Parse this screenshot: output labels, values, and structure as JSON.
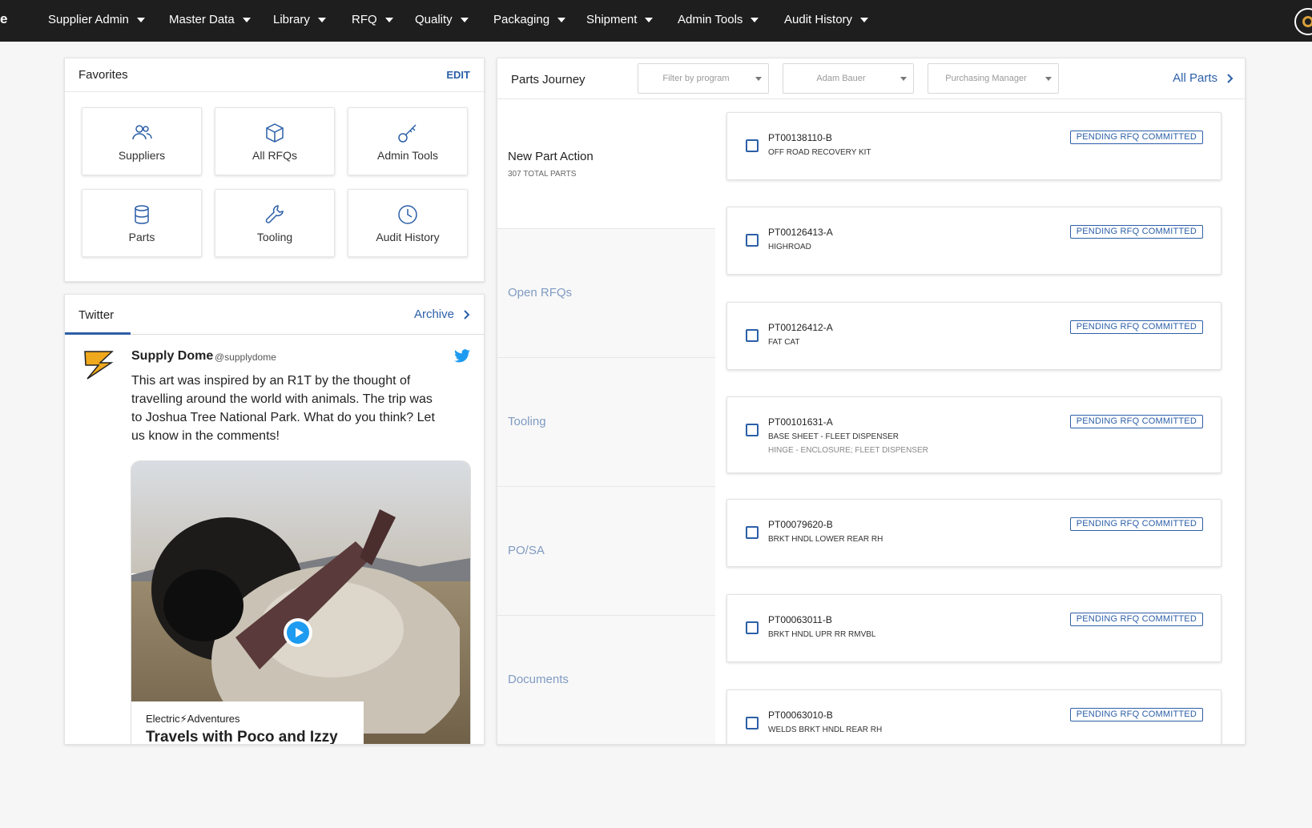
{
  "nav": {
    "brand_fragment": "e",
    "items": [
      {
        "label": "Supplier Admin"
      },
      {
        "label": "Master Data"
      },
      {
        "label": "Library"
      },
      {
        "label": "RFQ"
      },
      {
        "label": "Quality"
      },
      {
        "label": "Packaging"
      },
      {
        "label": "Shipment"
      },
      {
        "label": "Admin Tools"
      },
      {
        "label": "Audit History"
      }
    ]
  },
  "favorites": {
    "title": "Favorites",
    "edit_label": "EDIT",
    "tiles": [
      {
        "label": "Suppliers",
        "icon": "users-icon"
      },
      {
        "label": "All RFQs",
        "icon": "box-icon"
      },
      {
        "label": "Admin Tools",
        "icon": "key-icon"
      },
      {
        "label": "Parts",
        "icon": "database-icon"
      },
      {
        "label": "Tooling",
        "icon": "wrench-icon"
      },
      {
        "label": "Audit History",
        "icon": "clock-icon"
      }
    ]
  },
  "twitter": {
    "tab_label": "Twitter",
    "archive_label": "Archive",
    "tweet": {
      "name": "Supply Dome",
      "handle": "@supplydome",
      "text": "This art was inspired by an R1T by the thought of travelling around the world with animals. The trip was to Joshua Tree National Park. What do you think? Let us know in the comments!",
      "media_caption_brand": "Electric⚡Adventures",
      "media_caption_title": "Travels with Poco and Izzy"
    }
  },
  "parts_journey": {
    "title": "Parts Journey",
    "filters": [
      {
        "placeholder": "Filter by program"
      },
      {
        "value": "Adam Bauer"
      },
      {
        "value": "Purchasing Manager"
      }
    ],
    "all_parts_label": "All Parts",
    "stages": [
      {
        "name": "New Part Action",
        "sub": "307 TOTAL PARTS",
        "active": true
      },
      {
        "name": "Open RFQs"
      },
      {
        "name": "Tooling"
      },
      {
        "name": "PO/SA"
      },
      {
        "name": "Documents"
      }
    ],
    "parts": [
      {
        "id": "PT00138110-B",
        "desc": "OFF ROAD RECOVERY KIT",
        "status": "PENDING RFQ COMMITTED"
      },
      {
        "id": "PT00126413-A",
        "desc": "HIGHROAD",
        "status": "PENDING RFQ COMMITTED"
      },
      {
        "id": "PT00126412-A",
        "desc": "FAT CAT",
        "status": "PENDING RFQ COMMITTED"
      },
      {
        "id": "PT00101631-A",
        "desc": "BASE SHEET - FLEET DISPENSER",
        "desc2": "HINGE - ENCLOSURE; FLEET DISPENSER",
        "status": "PENDING RFQ COMMITTED"
      },
      {
        "id": "PT00079620-B",
        "desc": "BRKT HNDL LOWER REAR RH",
        "status": "PENDING RFQ COMMITTED"
      },
      {
        "id": "PT00063011-B",
        "desc": "BRKT HNDL UPR RR RMVBL",
        "status": "PENDING RFQ COMMITTED"
      },
      {
        "id": "PT00063010-B",
        "desc": "WELDS BRKT HNDL REAR RH",
        "status": "PENDING RFQ COMMITTED"
      }
    ]
  },
  "colors": {
    "nav_bg": "#1e1e1e",
    "accent_blue": "#2c5fa8",
    "stage_inactive": "#7f9bc2",
    "twitter_blue": "#1d9bf0",
    "logo_gold": "#f0a81c"
  }
}
